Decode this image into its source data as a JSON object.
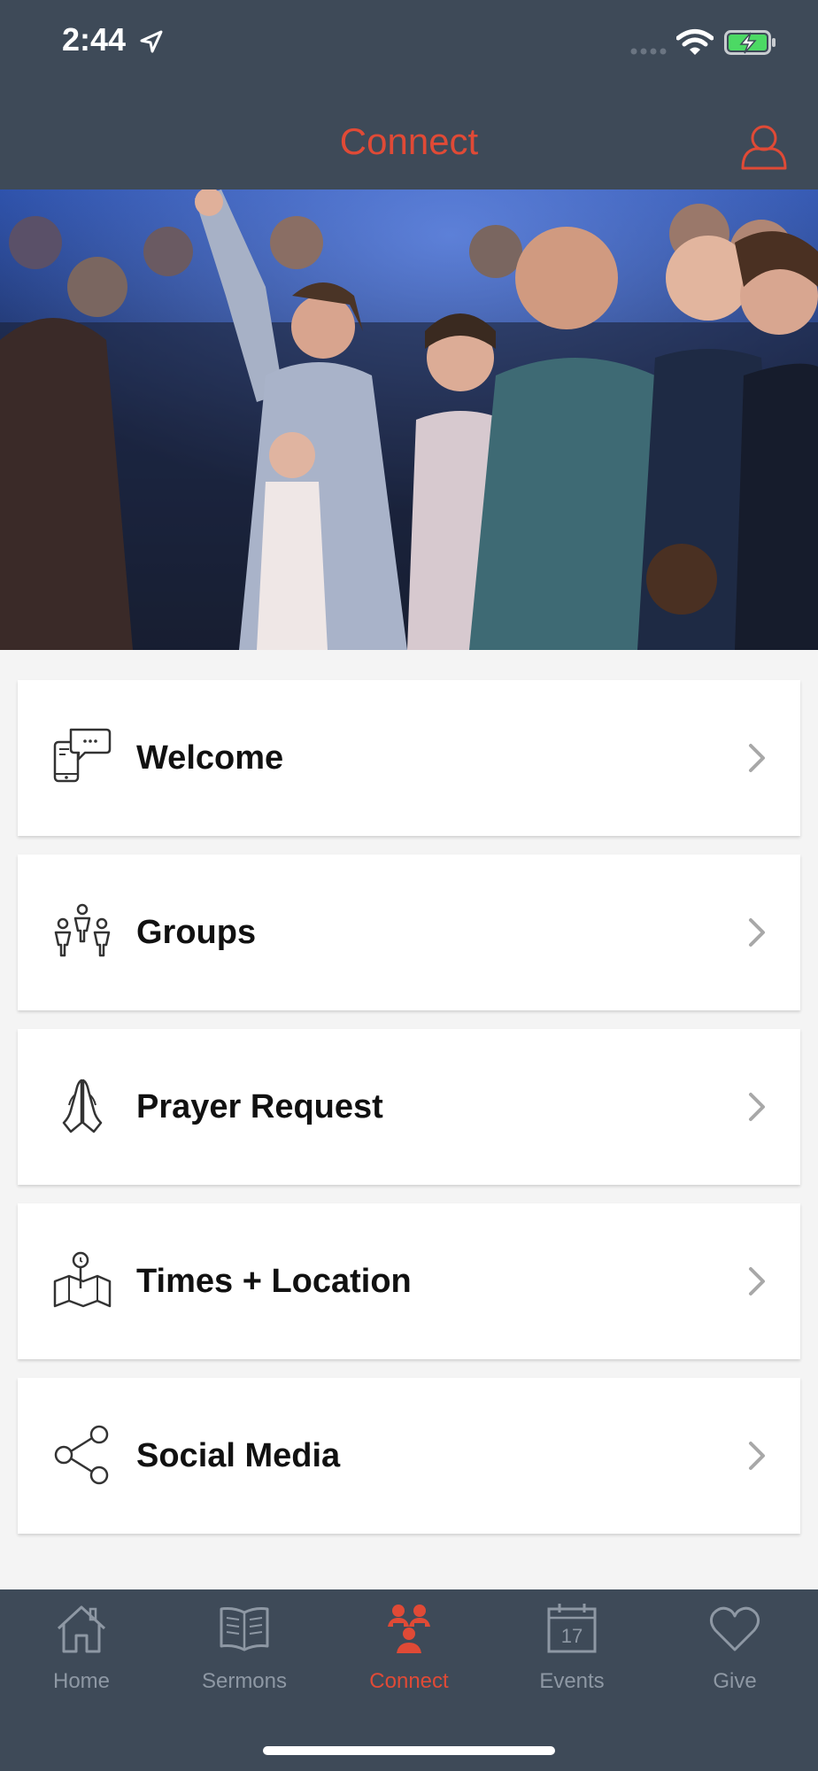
{
  "status": {
    "time": "2:44"
  },
  "header": {
    "title": "Connect"
  },
  "hero": {
    "description": "worship"
  },
  "menu": [
    {
      "label": "Welcome",
      "icon": "phone-chat-icon"
    },
    {
      "label": "Groups",
      "icon": "groups-icon"
    },
    {
      "label": "Prayer Request",
      "icon": "praying-hands-icon"
    },
    {
      "label": "Times + Location",
      "icon": "map-pin-icon"
    },
    {
      "label": "Social Media",
      "icon": "share-icon"
    }
  ],
  "tabs": [
    {
      "label": "Home",
      "icon": "home-icon",
      "active": false
    },
    {
      "label": "Sermons",
      "icon": "book-icon",
      "active": false
    },
    {
      "label": "Connect",
      "icon": "people-icon",
      "active": true
    },
    {
      "label": "Events",
      "icon": "calendar-icon",
      "active": false,
      "calendar_day": "17"
    },
    {
      "label": "Give",
      "icon": "heart-icon",
      "active": false
    }
  ],
  "colors": {
    "accent": "#e04a36",
    "bar": "#3e4a58",
    "tab_inactive": "#8e98a4"
  }
}
